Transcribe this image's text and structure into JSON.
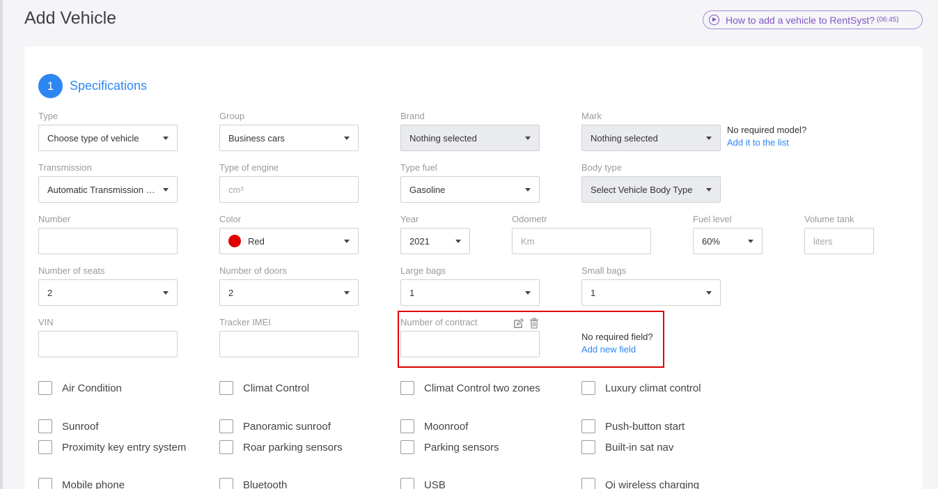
{
  "page": {
    "title": "Add Vehicle"
  },
  "video_link": {
    "label": "How to add a vehicle to RentSyst?",
    "duration": "(06:45)"
  },
  "section": {
    "number": "1",
    "title": "Specifications"
  },
  "fields": {
    "type": {
      "label": "Type",
      "value": "Choose type of vehicle"
    },
    "group": {
      "label": "Group",
      "value": "Business cars"
    },
    "brand": {
      "label": "Brand",
      "value": "Nothing selected"
    },
    "mark": {
      "label": "Mark",
      "value": "Nothing selected"
    },
    "transmission": {
      "label": "Transmission",
      "value": "Automatic Transmission (Automatic)"
    },
    "engine": {
      "label": "Type of engine",
      "placeholder": "cm³"
    },
    "fuel_type": {
      "label": "Type fuel",
      "value": "Gasoline"
    },
    "body_type": {
      "label": "Body type",
      "value": "Select Vehicle Body Type"
    },
    "number": {
      "label": "Number",
      "value": ""
    },
    "color": {
      "label": "Color",
      "value": "Red",
      "swatch": "#e00000"
    },
    "year": {
      "label": "Year",
      "value": "2021"
    },
    "odometer": {
      "label": "Odometr",
      "placeholder": "Km"
    },
    "fuel_level": {
      "label": "Fuel level",
      "value": "60%"
    },
    "volume_tank": {
      "label": "Volume tank",
      "placeholder": "liters"
    },
    "seats": {
      "label": "Number of seats",
      "value": "2"
    },
    "doors": {
      "label": "Number of doors",
      "value": "2"
    },
    "large_bags": {
      "label": "Large bags",
      "value": "1"
    },
    "small_bags": {
      "label": "Small bags",
      "value": "1"
    },
    "vin": {
      "label": "VIN",
      "value": ""
    },
    "tracker": {
      "label": "Tracker IMEI",
      "value": ""
    },
    "contract": {
      "label": "Number of contract",
      "value": ""
    }
  },
  "notes": {
    "model": {
      "text": "No required model?",
      "link": "Add it to the list"
    },
    "field": {
      "text": "No required field?",
      "link": "Add new field"
    }
  },
  "options": [
    "Air Condition",
    "Climat Control",
    "Climat Control two zones",
    "Luxury climat control",
    "Sunroof",
    "Panoramic sunroof",
    "Moonroof",
    "Push-button start",
    "Proximity key entry system",
    "Roar parking sensors",
    "Parking sensors",
    "Built-in sat nav",
    "Mobile phone",
    "Bluetooth",
    "USB",
    "Qi wireless charging"
  ],
  "colors": {
    "accent": "#2e86f2",
    "video_purple": "#7f56c6",
    "highlight": "#e00000"
  }
}
